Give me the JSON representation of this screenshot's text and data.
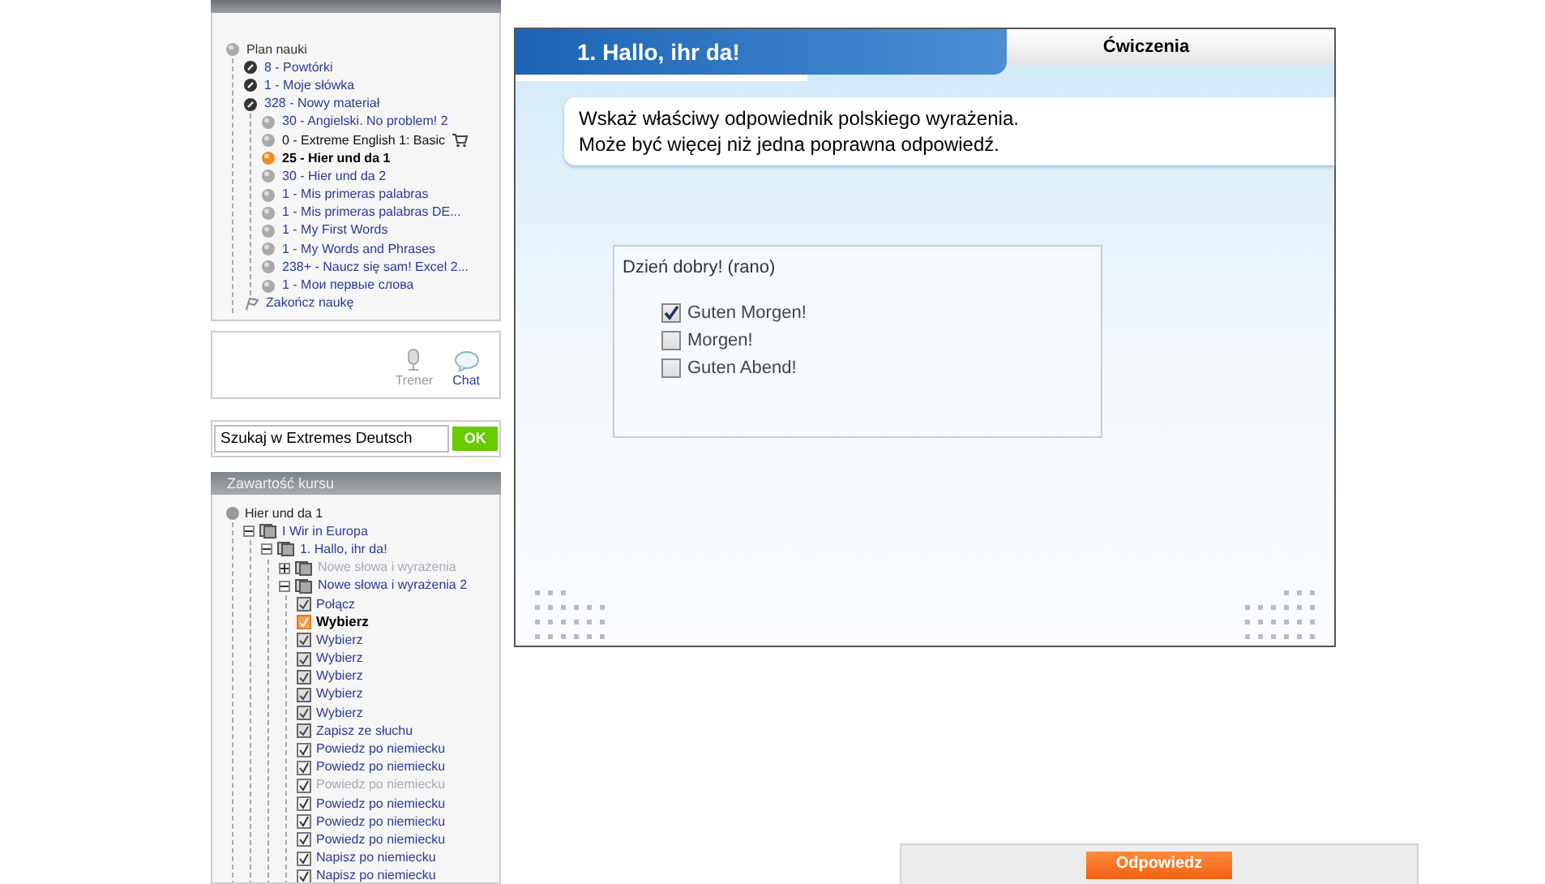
{
  "plan": {
    "items": [
      {
        "label": "Plan nauki",
        "kind": "root",
        "selected": false,
        "cart": false,
        "children": [
          {
            "label": "8 - Powtórki",
            "kind": "review",
            "selected": false,
            "cart": false
          },
          {
            "label": "1 - Moje słówka",
            "kind": "words",
            "selected": false,
            "cart": false
          },
          {
            "label": "328 - Nowy materiał",
            "kind": "new",
            "selected": false,
            "cart": false,
            "children": [
              {
                "label": "30 - Angielski. No problem! 2",
                "kind": "course",
                "selected": false,
                "cart": false
              },
              {
                "label": "0 - Extreme English 1: Basic",
                "kind": "course",
                "selected": false,
                "cart": true
              },
              {
                "label": "25 - Hier und da 1",
                "kind": "course",
                "selected": true,
                "cart": false
              },
              {
                "label": "30 - Hier und da 2",
                "kind": "course",
                "selected": false,
                "cart": false
              },
              {
                "label": "1 - Mis primeras palabras",
                "kind": "course",
                "selected": false,
                "cart": false
              },
              {
                "label": "1 - Mis primeras palabras DE...",
                "kind": "course",
                "selected": false,
                "cart": false
              },
              {
                "label": "1 - My First Words",
                "kind": "course",
                "selected": false,
                "cart": false
              },
              {
                "label": "1 - My Words and Phrases",
                "kind": "course",
                "selected": false,
                "cart": false
              },
              {
                "label": "238+ - Naucz się sam! Excel 2...",
                "kind": "course",
                "selected": false,
                "cart": false
              },
              {
                "label": "1 - Мои первые слова",
                "kind": "course",
                "selected": false,
                "cart": false
              }
            ]
          },
          {
            "label": "Zakończ naukę",
            "kind": "finish",
            "selected": false,
            "cart": false
          }
        ]
      }
    ]
  },
  "tools": [
    {
      "label": "Trener",
      "kind": "mic",
      "disabled": true
    },
    {
      "label": "Chat",
      "kind": "chat",
      "disabled": false
    }
  ],
  "search": {
    "value": "Szukaj w Extremes Deutsch",
    "button": "OK"
  },
  "contents": {
    "title": "Zawartość kursu",
    "items": [
      {
        "label": "Hier und da 1",
        "kind": "root",
        "selected": false,
        "disabled": false,
        "children": [
          {
            "label": "I Wir in Europa",
            "kind": "unit",
            "expanded": true,
            "selected": false,
            "disabled": false,
            "children": [
              {
                "label": "1. Hallo, ihr da!",
                "kind": "unit",
                "expanded": true,
                "selected": false,
                "disabled": false,
                "children": [
                  {
                    "label": "Nowe słowa i wyrażenia",
                    "kind": "unit",
                    "expanded": false,
                    "selected": false,
                    "disabled": true
                  },
                  {
                    "label": "Nowe słowa i wyrażenia 2",
                    "kind": "unit",
                    "expanded": true,
                    "selected": false,
                    "disabled": false,
                    "children": [
                      {
                        "label": "Połącz",
                        "kind": "exercise",
                        "selected": false,
                        "disabled": false
                      },
                      {
                        "label": "Wybierz",
                        "kind": "exercise",
                        "selected": true,
                        "disabled": false
                      },
                      {
                        "label": "Wybierz",
                        "kind": "exercise",
                        "selected": false,
                        "disabled": false
                      },
                      {
                        "label": "Wybierz",
                        "kind": "exercise",
                        "selected": false,
                        "disabled": false
                      },
                      {
                        "label": "Wybierz",
                        "kind": "exercise",
                        "selected": false,
                        "disabled": false
                      },
                      {
                        "label": "Wybierz",
                        "kind": "exercise",
                        "selected": false,
                        "disabled": false
                      },
                      {
                        "label": "Wybierz",
                        "kind": "exercise",
                        "selected": false,
                        "disabled": false
                      },
                      {
                        "label": "Zapisz ze słuchu",
                        "kind": "exercise",
                        "selected": false,
                        "disabled": false
                      },
                      {
                        "label": "Powiedz po niemiecku",
                        "kind": "task",
                        "selected": false,
                        "disabled": false
                      },
                      {
                        "label": "Powiedz po niemiecku",
                        "kind": "task",
                        "selected": false,
                        "disabled": false
                      },
                      {
                        "label": "Powiedz po niemiecku",
                        "kind": "task",
                        "selected": false,
                        "disabled": true
                      },
                      {
                        "label": "Powiedz po niemiecku",
                        "kind": "task",
                        "selected": false,
                        "disabled": false
                      },
                      {
                        "label": "Powiedz po niemiecku",
                        "kind": "task",
                        "selected": false,
                        "disabled": false
                      },
                      {
                        "label": "Powiedz po niemiecku",
                        "kind": "task",
                        "selected": false,
                        "disabled": false
                      },
                      {
                        "label": "Napisz po niemiecku",
                        "kind": "task",
                        "selected": false,
                        "disabled": false
                      },
                      {
                        "label": "Napisz po niemiecku",
                        "kind": "task",
                        "selected": false,
                        "disabled": false
                      }
                    ]
                  }
                ]
              }
            ]
          }
        ]
      }
    ]
  },
  "lesson": {
    "title": "1. Hallo, ihr da!",
    "tab": "Ćwiczenia",
    "instruction": [
      "Wskaż właściwy odpowiednik polskiego wyrażenia.",
      "Może być więcej niż jedna poprawna odpowiedź."
    ],
    "question": "Dzień dobry! (rano)",
    "options": [
      {
        "label": "Guten Morgen!",
        "checked": true
      },
      {
        "label": "Morgen!",
        "checked": false
      },
      {
        "label": "Guten Abend!",
        "checked": false
      }
    ]
  },
  "answer_button": "Odpowiedz"
}
